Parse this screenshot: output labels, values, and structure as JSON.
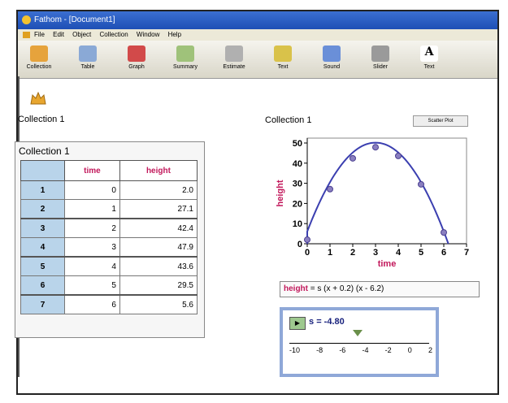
{
  "window": {
    "title": "Fathom - [Document1]",
    "menu": [
      "File",
      "Edit",
      "Object",
      "Collection",
      "Window",
      "Help"
    ]
  },
  "toolbar": [
    {
      "label": "Collection",
      "icon": "collection-icon",
      "color": "#e6a33c"
    },
    {
      "label": "Table",
      "icon": "table-icon",
      "color": "#8aa9d6"
    },
    {
      "label": "Graph",
      "icon": "graph-icon",
      "color": "#d24a4a"
    },
    {
      "label": "Summary",
      "icon": "summary-icon",
      "color": "#9fc27a"
    },
    {
      "label": "Estimate",
      "icon": "estimate-icon",
      "color": "#b0b0b0"
    },
    {
      "label": "Text",
      "icon": "text-icon",
      "color": "#d9c24a"
    },
    {
      "label": "Sound",
      "icon": "sound-icon",
      "color": "#6a8fd8"
    },
    {
      "label": "Slider",
      "icon": "slider-icon",
      "color": "#9a9a9a"
    },
    {
      "label": "Text",
      "icon": "text-a-icon",
      "color": "#ffffff"
    }
  ],
  "collection_icon": {
    "label": "Collection 1"
  },
  "case_table": {
    "title": "Collection 1",
    "columns": [
      "time",
      "height"
    ],
    "rows": [
      {
        "index": "1",
        "time": "0",
        "height": "2.0"
      },
      {
        "index": "2",
        "time": "1",
        "height": "27.1"
      },
      {
        "index": "3",
        "time": "2",
        "height": "42.4"
      },
      {
        "index": "4",
        "time": "3",
        "height": "47.9"
      },
      {
        "index": "5",
        "time": "4",
        "height": "43.6"
      },
      {
        "index": "6",
        "time": "5",
        "height": "29.5"
      },
      {
        "index": "7",
        "time": "6",
        "height": "5.6"
      }
    ]
  },
  "graph": {
    "title": "Collection 1",
    "button": "Scatter Plot"
  },
  "chart_data": {
    "type": "scatter",
    "title": "",
    "xlabel": "time",
    "ylabel": "height",
    "x": [
      0,
      1,
      2,
      3,
      4,
      5,
      6
    ],
    "y": [
      2.0,
      27.1,
      42.4,
      47.9,
      43.6,
      29.5,
      5.6
    ],
    "xlim": [
      0,
      7
    ],
    "ylim": [
      0,
      50
    ],
    "x_ticks": [
      "0",
      "1",
      "2",
      "3",
      "4",
      "5",
      "6",
      "7"
    ],
    "y_ticks": [
      "0",
      "10",
      "20",
      "30",
      "40",
      "50"
    ],
    "curve": {
      "a": -4.9,
      "r1": -0.2,
      "r2": 6.2
    },
    "point_color": "#8a7fc0",
    "curve_color": "#3b3fb0"
  },
  "equation": {
    "lhs": "height",
    "rhs": "= s (x + 0.2) (x - 6.2)"
  },
  "slider": {
    "name": "s",
    "value": "= -4.80",
    "ticks": [
      "-10",
      "-8",
      "-6",
      "-4",
      "-2",
      "0",
      "2"
    ]
  }
}
